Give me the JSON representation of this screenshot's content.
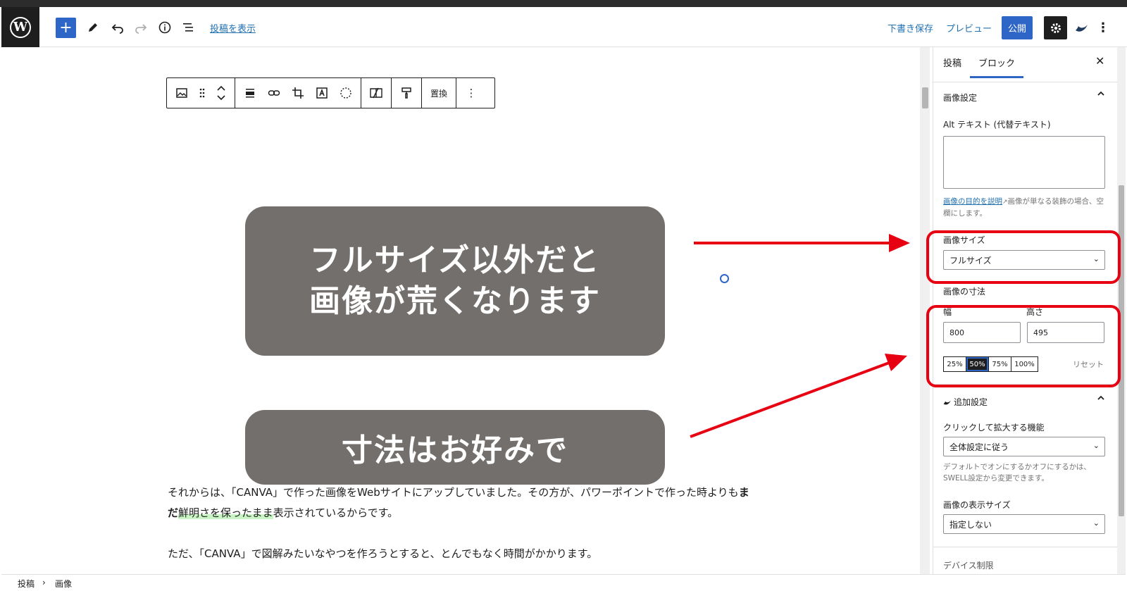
{
  "header": {
    "logo": "W",
    "add_block_icon": "+",
    "view_post": "投稿を表示",
    "draft_save": "下書き保存",
    "preview": "プレビュー",
    "publish": "公開"
  },
  "toolbar": {
    "replace_label": "置換"
  },
  "overlays": {
    "box1_line1": "フルサイズ以外だと",
    "box1_line2": "画像が荒くなります",
    "box2": "寸法はお好みで"
  },
  "content": {
    "para1_part1": "それからは、「CANVA」で作った画像をWebサイトにアップしていました。その方が、パワーポイントで作った時よりも",
    "para1_bold": "まだ",
    "para1_hl": "鮮明さを保ったまま",
    "para1_part2": "表示されているからです。",
    "para2": "ただ、「CANVA」で図解みたいなやつを作ろうとすると、とんでもなく時間がかかります。"
  },
  "sidebar": {
    "tab_post": "投稿",
    "tab_block": "ブロック",
    "close": "✕",
    "image_settings": "画像設定",
    "alt_label": "Alt テキスト (代替テキスト)",
    "alt_value": "",
    "help_link": "画像の目的を説明",
    "help_text": "画像が単なる装飾の場合、空欄にします。",
    "image_size_label": "画像サイズ",
    "image_size_value": "フルサイズ",
    "dimensions_label": "画像の寸法",
    "width_label": "幅",
    "height_label": "高さ",
    "width_value": "800",
    "height_value": "495",
    "pct_25": "25%",
    "pct_50": "50%",
    "pct_75": "75%",
    "pct_100": "100%",
    "reset": "リセット",
    "extra_settings": "追加設定",
    "click_zoom_label": "クリックして拡大する機能",
    "click_zoom_value": "全体設定に従う",
    "click_zoom_help": "デフォルトでオンにするかオフにするかは、SWELL設定から変更できます。",
    "display_size_label": "画像の表示サイズ",
    "display_size_value": "指定しない",
    "device_control": "デバイス制限"
  },
  "footer": {
    "crumb1": "投稿",
    "sep": "›",
    "crumb2": "画像"
  }
}
